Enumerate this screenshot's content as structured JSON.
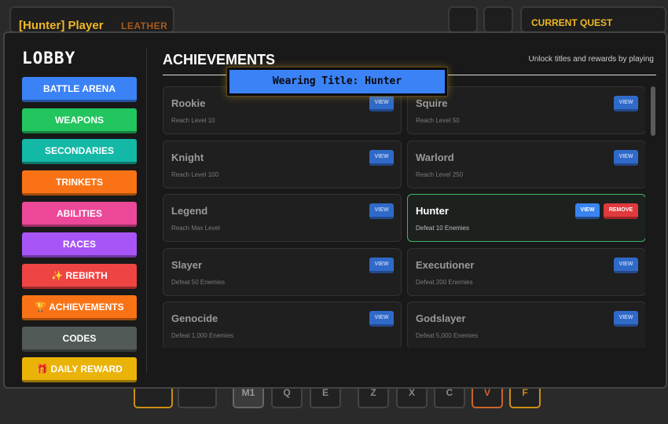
{
  "hud": {
    "player_name": "[Hunter] Player",
    "player_class": "LEATHER",
    "quest_title": "CURRENT QUEST"
  },
  "hotbar": {
    "keys": [
      "M1",
      "Q",
      "E",
      "Z",
      "X",
      "C",
      "V",
      "F"
    ]
  },
  "lobby": {
    "title": "LOBBY",
    "menu": [
      {
        "label": "BATTLE ARENA",
        "color": "#3b82f6"
      },
      {
        "label": "WEAPONS",
        "color": "#22c55e"
      },
      {
        "label": "SECONDARIES",
        "color": "#14b8a6"
      },
      {
        "label": "TRINKETS",
        "color": "#f97316"
      },
      {
        "label": "ABILITIES",
        "color": "#ec4899"
      },
      {
        "label": "RACES",
        "color": "#a855f7"
      },
      {
        "label": "✨ REBIRTH",
        "color": "#ef4444"
      },
      {
        "label": "🏆 ACHIEVEMENTS",
        "color": "#f97316"
      },
      {
        "label": "CODES",
        "color": "#525a57"
      },
      {
        "label": "🎁 DAILY REWARD",
        "color": "#eab308"
      }
    ]
  },
  "achievements": {
    "title": "ACHIEVEMENTS",
    "subtitle": "Unlock titles and rewards by playing",
    "view_label": "VIEW",
    "remove_label": "REMOVE",
    "items": [
      {
        "name": "Rookie",
        "desc": "Reach Level 10",
        "active": false
      },
      {
        "name": "Squire",
        "desc": "Reach Level 50",
        "active": false
      },
      {
        "name": "Knight",
        "desc": "Reach Level 100",
        "active": false
      },
      {
        "name": "Warlord",
        "desc": "Reach Level 250",
        "active": false
      },
      {
        "name": "Legend",
        "desc": "Reach Max Level",
        "active": false
      },
      {
        "name": "Hunter",
        "desc": "Defeat 10 Enemies",
        "active": true
      },
      {
        "name": "Slayer",
        "desc": "Defeat 50 Enemies",
        "active": false
      },
      {
        "name": "Executioner",
        "desc": "Defeat 200 Enemies",
        "active": false
      },
      {
        "name": "Genocide",
        "desc": "Defeat 1,000 Enemies",
        "active": false
      },
      {
        "name": "Godslayer",
        "desc": "Defeat 5,000 Enemies",
        "active": false
      }
    ]
  },
  "toast": {
    "text": "Wearing Title: Hunter"
  },
  "colors": {
    "accent_gold": "#f0b823",
    "active_border": "#3fb36a",
    "view_button": "#2f6ac9",
    "remove_button": "#e0393e"
  }
}
